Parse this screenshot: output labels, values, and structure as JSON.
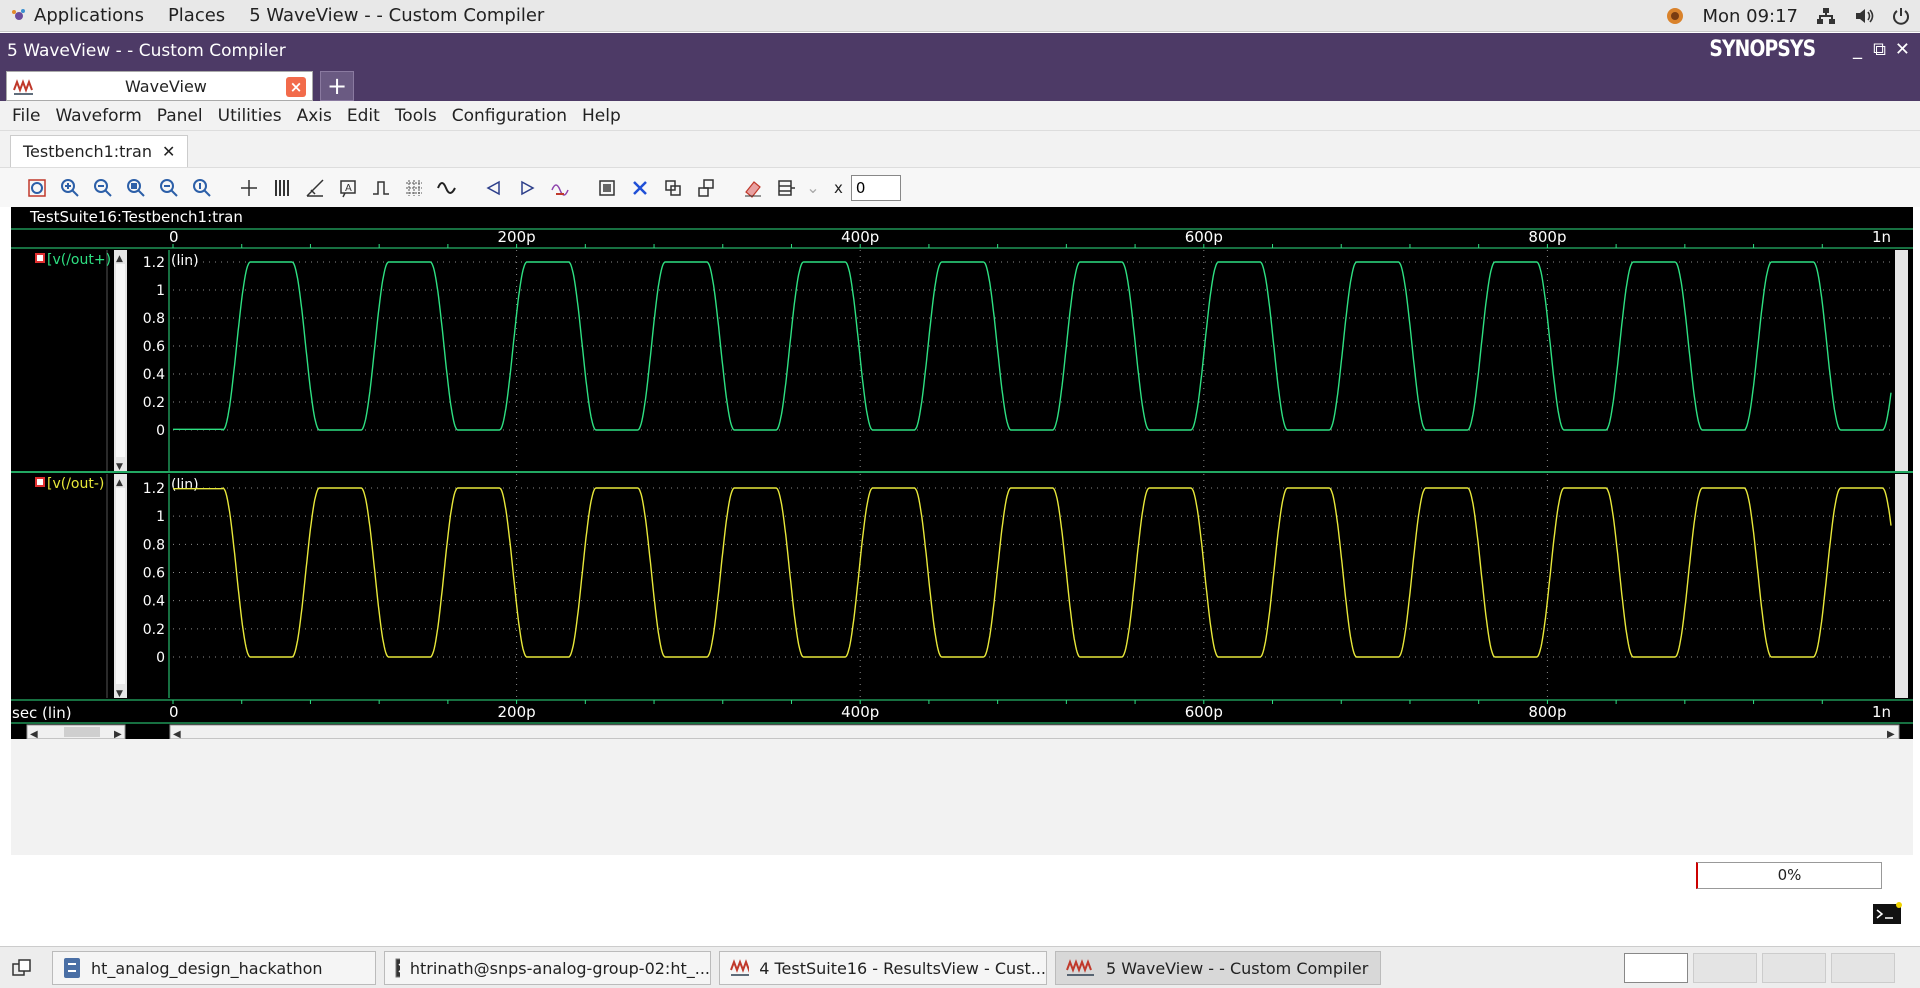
{
  "topbar": {
    "applications": "Applications",
    "places": "Places",
    "active_window": "5 WaveView -  - Custom Compiler",
    "clock": "Mon 09:17"
  },
  "window": {
    "title": "5 WaveView -  - Custom Compiler",
    "logo": "SYNOPSYS"
  },
  "tabs": {
    "main_tab": "WaveView",
    "add": "+"
  },
  "menubar": [
    "File",
    "Waveform",
    "Panel",
    "Utilities",
    "Axis",
    "Edit",
    "Tools",
    "Configuration",
    "Help"
  ],
  "doc_tab": "Testbench1:tran",
  "toolbar": {
    "x_label": "x",
    "x_value": "0"
  },
  "wave": {
    "header": "TestSuite16:Testbench1:tran",
    "x_axis_label": "sec (lin)",
    "x_ticks": [
      "0",
      "200p",
      "400p",
      "600p",
      "800p",
      "1n"
    ],
    "panels": [
      {
        "signal": "v(/out+)",
        "color": "#2ee082",
        "scale": "(lin)",
        "y_ticks": [
          "1.2",
          "1",
          "0.8",
          "0.6",
          "0.4",
          "0.2",
          "0"
        ]
      },
      {
        "signal": "v(/out-)",
        "color": "#e8e83a",
        "scale": "(lin)",
        "y_ticks": [
          "1.2",
          "1",
          "0.8",
          "0.6",
          "0.4",
          "0.2",
          "0"
        ]
      }
    ]
  },
  "chart_data": {
    "type": "line",
    "x_unit": "sec",
    "xlim": [
      0,
      1e-09
    ],
    "ylim": [
      0,
      1.2
    ],
    "period_s": 8.05e-11,
    "high_v": 1.2,
    "low_v": 0.0,
    "series": [
      {
        "name": "v(/out+)",
        "phase": "starts low, first rise ~3e-11"
      },
      {
        "name": "v(/out-)",
        "phase": "starts high, complementary to v(/out+)"
      }
    ]
  },
  "status": {
    "progress": "0%"
  },
  "taskbar": {
    "items": [
      "ht_analog_design_hackathon",
      "htrinath@snps-analog-group-02:ht_...",
      "4 TestSuite16 - ResultsView - Cust...",
      "5 WaveView -  - Custom Compiler"
    ]
  }
}
